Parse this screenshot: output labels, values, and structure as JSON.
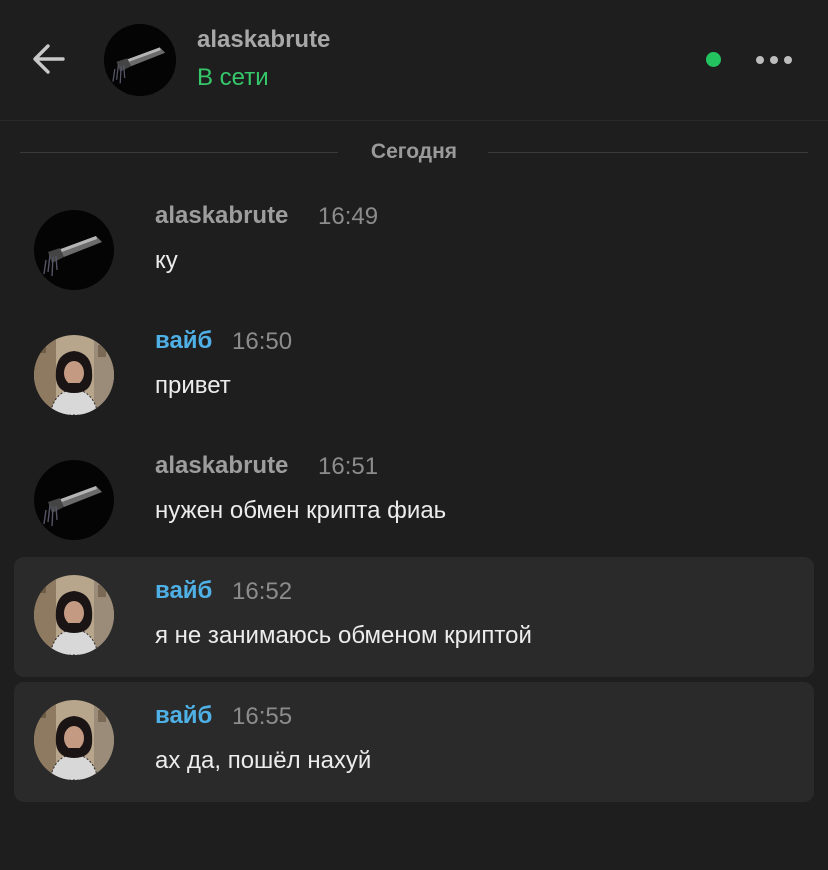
{
  "header": {
    "contact_name": "alaskabrute",
    "status": "В сети",
    "status_color": "#35c76a",
    "online_indicator_color": "#23c35f",
    "back_icon": "arrow-left-icon",
    "more_icon": "more-horizontal-icon"
  },
  "divider": {
    "label": "Сегодня"
  },
  "messages": [
    {
      "author": "alaskabrute",
      "time": "16:49",
      "text": "ку",
      "avatar": "alaskabrute-avatar",
      "highlighted": false
    },
    {
      "author": "вайб",
      "time": "16:50",
      "text": "привет",
      "avatar": "vibe-avatar",
      "highlighted": false
    },
    {
      "author": "alaskabrute",
      "time": "16:51",
      "text": "нужен обмен крипта фиаь",
      "avatar": "alaskabrute-avatar",
      "highlighted": false
    },
    {
      "author": "вайб",
      "time": "16:52",
      "text": "я не занимаюсь обменом криптой",
      "avatar": "vibe-avatar",
      "highlighted": true
    },
    {
      "author": "вайб",
      "time": "16:55",
      "text": "ах да, пошёл нахуй",
      "avatar": "vibe-avatar",
      "highlighted": true
    }
  ]
}
